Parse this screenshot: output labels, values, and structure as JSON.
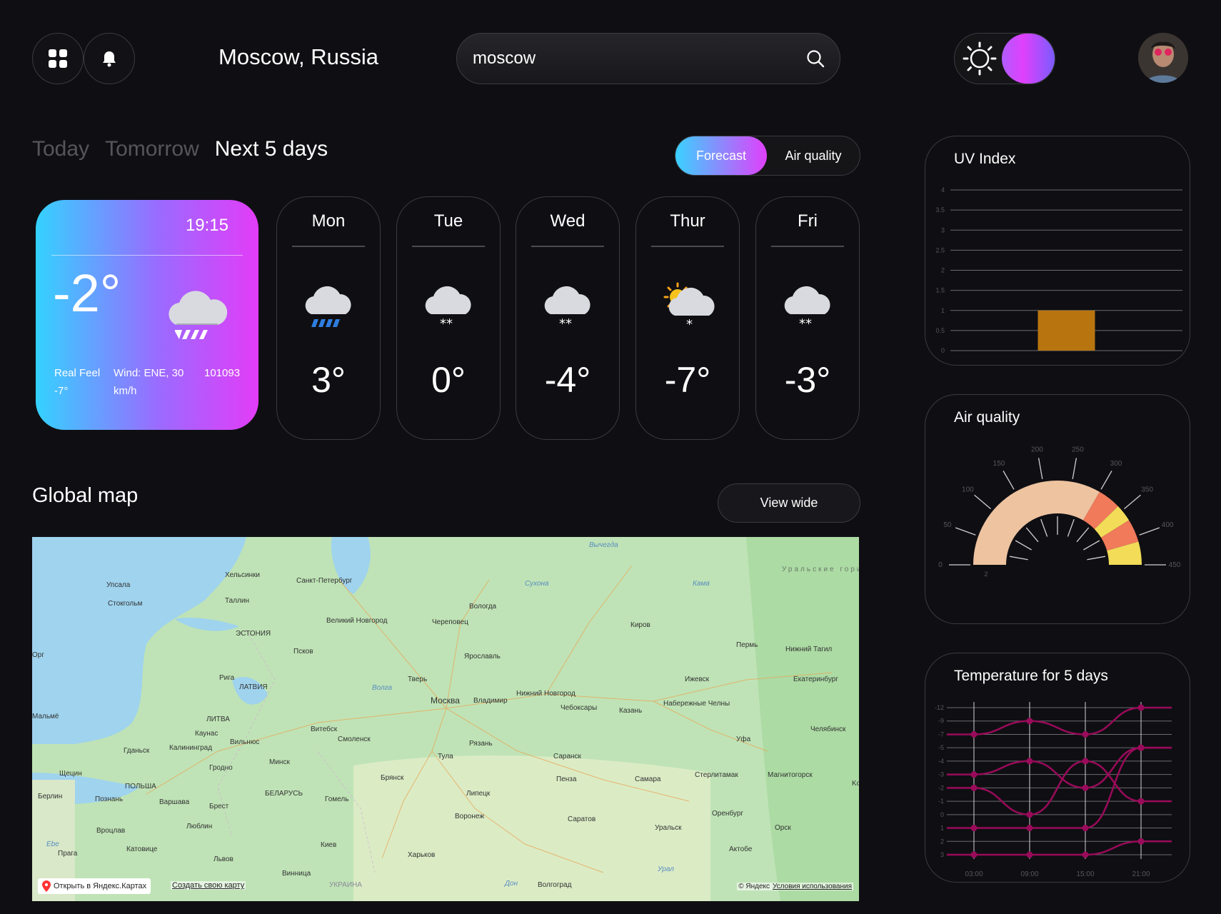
{
  "header": {
    "location": "Moscow, Russia",
    "search_value": "moscow",
    "avatar_alt": "user-avatar"
  },
  "tabs": {
    "items": [
      "Today",
      "Tomorrow",
      "Next 5 days"
    ],
    "active": "Next 5 days",
    "segment": {
      "on": "Forecast",
      "off": "Air quality"
    }
  },
  "today": {
    "time": "19:15",
    "temp": "-2°",
    "real_feel_label": "Real Feel",
    "real_feel_value": "-7°",
    "wind_line1": "Wind: ENE, 30",
    "wind_line2": "km/h",
    "pressure": "101093",
    "icon": "rain-cloud-icon"
  },
  "days": [
    {
      "name": "Mon",
      "temp": "3°",
      "icon": "rain-cloud-icon"
    },
    {
      "name": "Tue",
      "temp": "0°",
      "icon": "snow-cloud-icon"
    },
    {
      "name": "Wed",
      "temp": "-4°",
      "icon": "snow-cloud-icon"
    },
    {
      "name": "Thur",
      "temp": "-7°",
      "icon": "sun-snow-cloud-icon"
    },
    {
      "name": "Fri",
      "temp": "-3°",
      "icon": "snow-cloud-icon"
    }
  ],
  "map_section": {
    "title": "Global map",
    "view_wide": "View wide",
    "open_yandex": "Открыть в Яндекс.Картах",
    "create_map": "Создать свою карту",
    "copyright": "© Яндекс",
    "terms": "Условия использования",
    "cities": [
      "Хельсинки",
      "Санкт-Петербург",
      "Таллин",
      "Упсала",
      "Стокгольм",
      "ЭСТОНИЯ",
      "Великий Новгород",
      "Псков",
      "Вологда",
      "Череповец",
      "Ярославль",
      "Киров",
      "Пермь",
      "Нижний Тагил",
      "Рига",
      "ЛАТВИЯ",
      "Тверь",
      "Москва",
      "Владимир",
      "Нижний Новгород",
      "Чебоксары",
      "Казань",
      "Ижевск",
      "Екатеринбург",
      "Набережные Челны",
      "Мальмё",
      "ЛИТВА",
      "Каунас",
      "Вильнюс",
      "Калининград",
      "Гданьск",
      "Витебск",
      "Смоленск",
      "Рязань",
      "Тула",
      "Саранск",
      "Уфа",
      "Челябинск",
      "Минск",
      "Гродно",
      "Брянск",
      "Пенза",
      "Самара",
      "Стерлитамак",
      "Магнитогорск",
      "Щецин",
      "ПОЛЬША",
      "БЕЛАРУСЬ",
      "Берлин",
      "Познань",
      "Варшава",
      "Брест",
      "Гомель",
      "Липецк",
      "Воронеж",
      "Саратов",
      "Оренбург",
      "Орск",
      "Вроцлав",
      "Люблин",
      "Уральск",
      "Прага",
      "Катовице",
      "Львов",
      "Киев",
      "Харьков",
      "Актобе",
      "Винница",
      "Волгоград",
      "УКРАИНА",
      "Сухона",
      "Кама",
      "Волга",
      "Урал",
      "Дон",
      "Вычегда",
      "Уральские горы",
      "Ebe",
      "Орг",
      "Ko"
    ]
  },
  "uv_card": {
    "title": "UV Index",
    "chart_data": {
      "type": "bar",
      "categories": [
        ""
      ],
      "values": [
        1
      ],
      "ylim": [
        0,
        4
      ],
      "yticks": [
        "4",
        "3.5",
        "3",
        "2.5",
        "2",
        "1.5",
        "1",
        "0.5",
        "0"
      ],
      "bar_color": "#b8750f"
    }
  },
  "air_card": {
    "title": "Air quality",
    "chart_data": {
      "type": "gauge",
      "ticks": [
        "0",
        "50",
        "100",
        "150",
        "200",
        "250",
        "300",
        "350",
        "400",
        "450"
      ],
      "range": [
        0,
        450
      ],
      "bands": [
        {
          "from": 0,
          "to": 300,
          "color": "#eec3a0"
        },
        {
          "from": 300,
          "to": 340,
          "color": "#f07a5a"
        },
        {
          "from": 340,
          "to": 370,
          "color": "#f2dc58"
        },
        {
          "from": 370,
          "to": 410,
          "color": "#f07a5a"
        },
        {
          "from": 410,
          "to": 450,
          "color": "#f2dc58"
        }
      ],
      "bottom_label": "2"
    }
  },
  "temp_card": {
    "title": "Temperature for 5 days",
    "chart_data": {
      "type": "line",
      "x": [
        "03:00",
        "09:00",
        "15:00",
        "21:00"
      ],
      "y_ticks": [
        "-12",
        "-9",
        "-7",
        "-5",
        "-4",
        "-3",
        "-2",
        "-1",
        "0",
        "1",
        "2",
        "3"
      ],
      "line_color": "#9a0a5a",
      "series": [
        {
          "values": [
            -7,
            -9,
            -7,
            -12
          ]
        },
        {
          "values": [
            -3,
            -4,
            -2,
            -5
          ]
        },
        {
          "values": [
            -2,
            0,
            -4,
            -1
          ]
        },
        {
          "values": [
            1,
            1,
            1,
            -5
          ]
        },
        {
          "values": [
            3,
            3,
            3,
            2
          ]
        }
      ]
    }
  },
  "colors": {
    "accent_cyan": "#34d2ff",
    "accent_magenta": "#e33cf7",
    "background": "#0f0f13"
  }
}
